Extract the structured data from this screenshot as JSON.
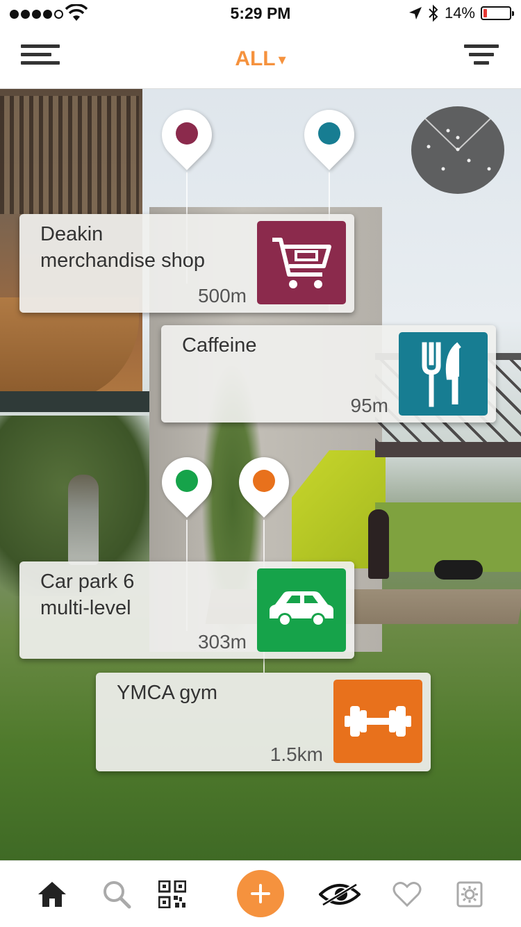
{
  "status_bar": {
    "time": "5:29 PM",
    "battery_text": "14%",
    "battery_level": 0.14,
    "signal_bars_filled": 4,
    "signal_bars_total": 5,
    "battery_color": "#e53935"
  },
  "nav": {
    "title": "ALL",
    "caret": "▾",
    "menu_icon": "hamburger-icon",
    "filter_icon": "filter-icon"
  },
  "accent_color": "#f5923e",
  "pois": [
    {
      "name_line1": "Deakin",
      "name_line2": "merchandise shop",
      "distance": "500m",
      "icon": "shopping-cart-icon",
      "color": "#8b2a4c"
    },
    {
      "name_line1": "Caffeine",
      "name_line2": "",
      "distance": "95m",
      "icon": "fork-knife-icon",
      "color": "#177d92"
    },
    {
      "name_line1": "Car park 6",
      "name_line2": "multi-level",
      "distance": "303m",
      "icon": "car-icon",
      "color": "#16a34a"
    },
    {
      "name_line1": "YMCA gym",
      "name_line2": "",
      "distance": "1.5km",
      "icon": "dumbbell-icon",
      "color": "#e8711c"
    }
  ],
  "tabbar": {
    "items": [
      "home-icon",
      "search-icon",
      "qr-code-icon",
      "add-icon",
      "ar-eye-icon",
      "heart-icon",
      "settings-icon"
    ],
    "add_label": "+"
  }
}
